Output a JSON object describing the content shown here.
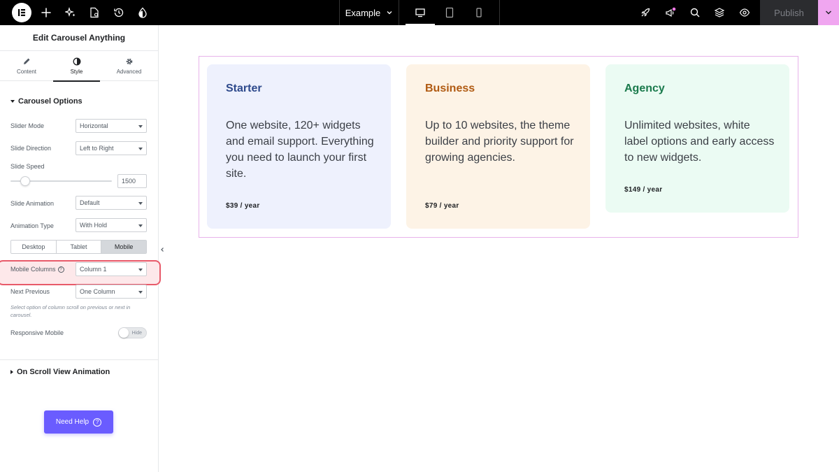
{
  "topbar": {
    "document_name": "Example",
    "publish_label": "Publish"
  },
  "panel": {
    "title": "Edit Carousel Anything",
    "tabs": [
      {
        "label": "Content",
        "icon": "pencil-icon"
      },
      {
        "label": "Style",
        "icon": "contrast-icon"
      },
      {
        "label": "Advanced",
        "icon": "gear-icon"
      }
    ],
    "sections": {
      "carousel_options": "Carousel Options",
      "scroll_animation": "On Scroll View Animation"
    },
    "controls": {
      "slider_mode": {
        "label": "Slider Mode",
        "value": "Horizontal"
      },
      "slide_direction": {
        "label": "Slide Direction",
        "value": "Left to Right"
      },
      "slide_speed": {
        "label": "Slide Speed",
        "value": "1500"
      },
      "slide_animation": {
        "label": "Slide Animation",
        "value": "Default"
      },
      "animation_type": {
        "label": "Animation Type",
        "value": "With Hold"
      },
      "device_tabs": [
        "Desktop",
        "Tablet",
        "Mobile"
      ],
      "mobile_columns": {
        "label": "Mobile Columns",
        "value": "Column 1"
      },
      "next_previous": {
        "label": "Next Previous",
        "value": "One Column"
      },
      "description": "Select option of column scroll on previous or next in carousel.",
      "responsive_mobile": {
        "label": "Responsive Mobile",
        "toggle": "Hide"
      }
    },
    "need_help": "Need Help"
  },
  "cards": [
    {
      "title": "Starter",
      "body": "One website, 120+ widgets and email support. Everything you need to launch your first site.",
      "price": "$39 / year",
      "bg": "#eef1fd",
      "title_color": "#2e4a8c"
    },
    {
      "title": "Business",
      "body": "Up to 10 websites, the theme builder and priority support for growing agencies.",
      "price": "$79 / year",
      "bg": "#fdf3e6",
      "title_color": "#b05a12"
    },
    {
      "title": "Agency",
      "body": "Unlimited websites, white label options and early access to new widgets.",
      "price": "$149 / year",
      "bg": "#ebfbf3",
      "title_color": "#1a7a4c"
    }
  ],
  "colors": {
    "accent": "#6a5cff",
    "publish_arrow": "#f0a6f0",
    "highlight_border": "#e85a6a"
  }
}
